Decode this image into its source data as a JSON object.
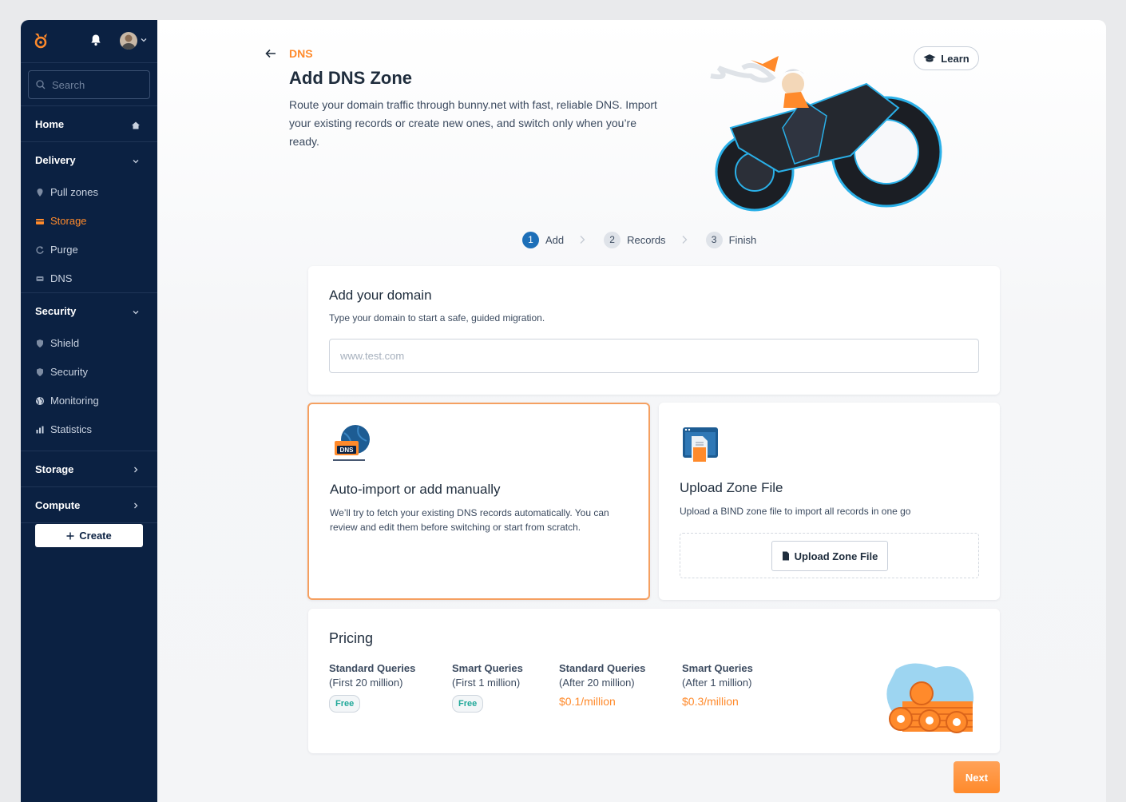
{
  "sidebar": {
    "search_placeholder": "Search",
    "home_label": "Home",
    "delivery": {
      "label": "Delivery",
      "items": [
        {
          "label": "Pull zones",
          "icon": "pin-icon"
        },
        {
          "label": "Storage",
          "icon": "storage-icon",
          "active": true
        },
        {
          "label": "Purge",
          "icon": "refresh-icon"
        },
        {
          "label": "DNS",
          "icon": "dns-icon"
        }
      ]
    },
    "security": {
      "label": "Security",
      "items": [
        {
          "label": "Shield",
          "icon": "shield-icon"
        },
        {
          "label": "Security",
          "icon": "shield-icon"
        },
        {
          "label": "Monitoring",
          "icon": "globe-icon"
        },
        {
          "label": "Statistics",
          "icon": "bar-chart-icon"
        }
      ]
    },
    "storage_label": "Storage",
    "compute_label": "Compute",
    "create_label": "Create"
  },
  "header": {
    "breadcrumb": "DNS",
    "title": "Add DNS Zone",
    "intro": "Route your domain traffic through bunny.net with fast, reliable DNS. Import your existing records or create new ones, and switch only when you’re ready.",
    "learn_label": "Learn"
  },
  "steps": [
    {
      "num": "1",
      "label": "Add",
      "active": true
    },
    {
      "num": "2",
      "label": "Records"
    },
    {
      "num": "3",
      "label": "Finish"
    }
  ],
  "domain_card": {
    "title": "Add your domain",
    "subtitle": "Type your domain to start a safe, guided migration.",
    "placeholder": "www.test.com",
    "value": ""
  },
  "auto_card": {
    "title": "Auto-import or add manually",
    "description": "We’ll try to fetch your existing DNS records automatically. You can review and edit them before switching or start from scratch.",
    "icon_text": "DNS"
  },
  "upload_card": {
    "title": "Upload Zone File",
    "description": "Upload a BIND zone file to import all records in one go",
    "button_label": "Upload Zone File"
  },
  "pricing": {
    "title": "Pricing",
    "columns": [
      {
        "name": "Standard Queries",
        "sub": "(First 20 million)",
        "badge": "Free"
      },
      {
        "name": "Smart Queries",
        "sub": "(First 1 million)",
        "badge": "Free"
      },
      {
        "name": "Standard Queries",
        "sub": "(After 20 million)",
        "price": "$0.1/million"
      },
      {
        "name": "Smart Queries",
        "sub": "(After 1 million)",
        "price": "$0.3/million"
      }
    ]
  },
  "next_label": "Next",
  "colors": {
    "sidebar_bg": "#0b2142",
    "accent": "#ff8a2b",
    "step_active": "#1d6fb8",
    "free_badge": "#22a99a"
  }
}
